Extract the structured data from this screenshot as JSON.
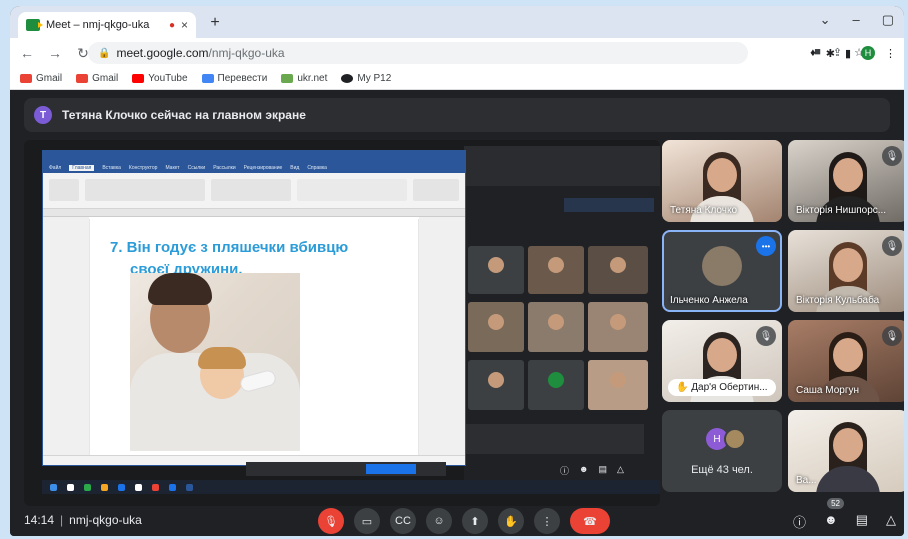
{
  "browser": {
    "tab_title": "Meet – nmj-qkgo-uka",
    "tab_close": "×",
    "new_tab": "+",
    "window_controls": [
      "⌄",
      "–",
      "▢"
    ],
    "url_host": "meet.google.com",
    "url_path": "/nmj-qkgo-uka",
    "profile_initial": "H"
  },
  "bookmarks": [
    {
      "label": "Gmail",
      "color": "#ea4335"
    },
    {
      "label": "Gmail",
      "color": "#ea4335"
    },
    {
      "label": "YouTube",
      "color": "#ff0000"
    },
    {
      "label": "Перевести",
      "color": "#4285f4"
    },
    {
      "label": "ukr.net",
      "color": "#6aa84f"
    },
    {
      "label": "My P12",
      "color": "#202124"
    }
  ],
  "banner": {
    "initial": "T",
    "text": "Тетяна Клочко сейчас на главном экране"
  },
  "presentation": {
    "slide_text_line1": "7.  Він годує з пляшечки вбивцю",
    "slide_text_line2": "своєї дружини.",
    "word_tabs": [
      "Файл",
      "Главная",
      "Вставка",
      "Конструктор",
      "Макет",
      "Ссылки",
      "Рассылки",
      "Рецензирование",
      "Вид",
      "Справка"
    ]
  },
  "participants": [
    {
      "name": "Тетяна Клочко",
      "muted": false
    },
    {
      "name": "Вікторія Нишпорс...",
      "muted": true
    },
    {
      "name": "Ільченко Анжела",
      "muted": false,
      "speaking": true
    },
    {
      "name": "Вікторія Кульбаба",
      "muted": true
    },
    {
      "name": "Дар'я Обертин...",
      "muted": true
    },
    {
      "name": "Саша Моргун",
      "muted": true
    },
    {
      "name": "Ещё 43 чел.",
      "initial": "H"
    },
    {
      "name": "Ва...",
      "muted": false
    }
  ],
  "bottom": {
    "time": "14:14",
    "separator": "|",
    "meeting_code": "nmj-qkgo-uka",
    "participants_count": "52"
  }
}
